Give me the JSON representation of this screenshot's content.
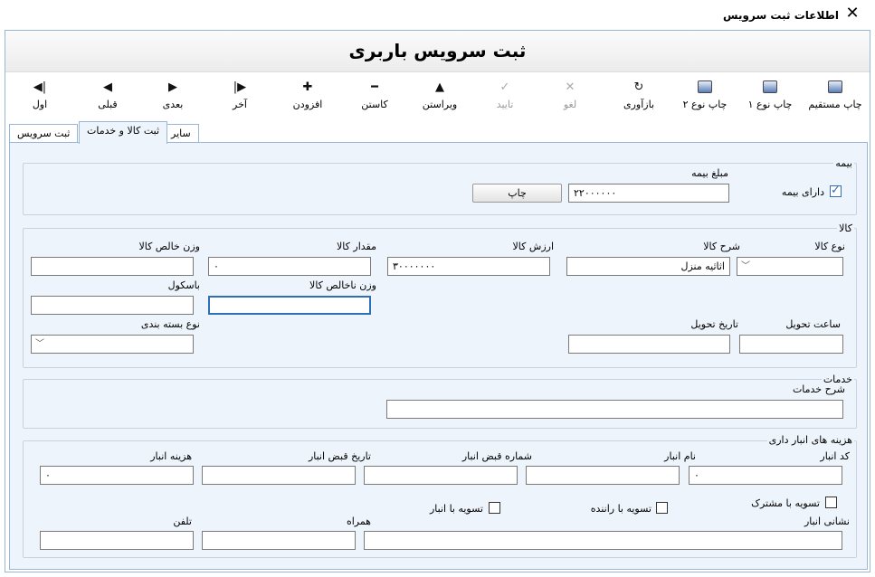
{
  "window": {
    "title": "اطلاعات ثبت سرویس",
    "close": "✕"
  },
  "page_title": "ثبت سرویس باربری",
  "toolbar": {
    "direct_print": "چاپ مستقیم",
    "print_type1": "چاپ نوع ۱",
    "print_type2": "چاپ نوع ۲",
    "refresh": "بازآوری",
    "cancel": "لغو",
    "confirm": "تایید",
    "edit": "ویراستن",
    "remove": "کاستن",
    "add": "افزودن",
    "last": "آخر",
    "next": "بعدی",
    "prev": "قبلی",
    "first": "اول",
    "icons": {
      "refresh": "↻",
      "cancel": "✕",
      "confirm": "✓",
      "edit": "▲",
      "remove": "━",
      "add": "✚",
      "last": "▶|",
      "next": "▶",
      "prev": "◀",
      "first": "|◀"
    }
  },
  "tabs": [
    "ثبت سرویس",
    "ثبت کالا و خدمات",
    "سایر"
  ],
  "insurance": {
    "group": "بیمه",
    "has_insurance": "دارای بیمه",
    "amount_label": "مبلغ بیمه",
    "amount_value": "۲۲۰۰۰۰۰۰",
    "print_button": "چاپ"
  },
  "goods": {
    "group": "کالا",
    "type_label": "نوع کالا",
    "desc_label": "شرح کالا",
    "desc_value": "اثاثیه منزل",
    "value_label": "ارزش کالا",
    "value_value": "۳۰۰۰۰۰۰۰",
    "qty_label": "مقدار کالا",
    "qty_value": "۰",
    "net_weight_label": "وزن خالص کالا",
    "gross_weight_label": "وزن ناخالص کالا",
    "scale_label": "باسکول",
    "delivery_time_label": "ساعت تحویل",
    "delivery_date_label": "تاریخ تحویل",
    "packing_label": "نوع بسته بندی"
  },
  "services": {
    "group": "خدمات",
    "desc_label": "شرح خدمات"
  },
  "warehouse": {
    "group": "هزینه های انبار داری",
    "code_label": "کد انبار",
    "code_value": "۰",
    "name_label": "نام انبار",
    "receipt_no_label": "شماره قبض انبار",
    "receipt_date_label": "تاریخ قبض انبار",
    "cost_label": "هزینه انبار",
    "cost_value": "۰",
    "settle_customer": "تسویه با مشترک",
    "settle_driver": "تسویه با راننده",
    "settle_warehouse": "تسویه با انبار",
    "address_label": "نشانی انبار",
    "mobile_label": "همراه",
    "phone_label": "تلفن"
  }
}
